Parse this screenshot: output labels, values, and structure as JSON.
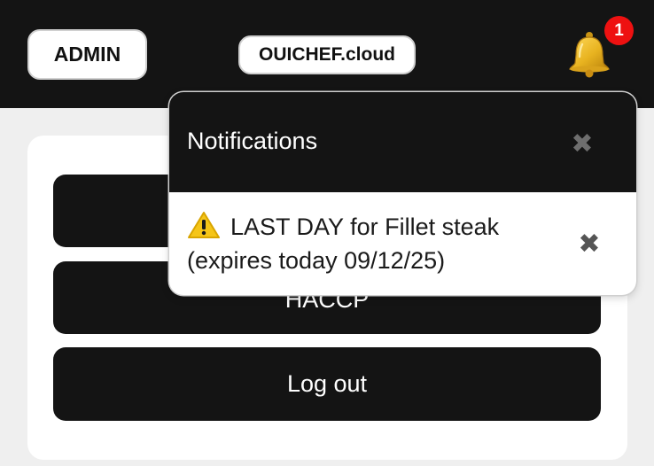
{
  "header": {
    "role_label": "ADMIN",
    "brand_label": "OUICHEF.cloud",
    "notification_count": "1"
  },
  "menu": {
    "items": [
      {
        "label": ""
      },
      {
        "label": "HACCP"
      },
      {
        "label": "Log out"
      }
    ]
  },
  "notifications": {
    "title": "Notifications",
    "close_glyph": "✖",
    "items": [
      {
        "icon": "warning-icon",
        "line1": "LAST DAY for Fillet steak",
        "line2": "(expires today 09/12/25)",
        "dismiss_glyph": "✖"
      }
    ]
  },
  "colors": {
    "bar": "#141414",
    "badge": "#ee1111",
    "bell": "#e8b320",
    "warning": "#f5c518"
  }
}
